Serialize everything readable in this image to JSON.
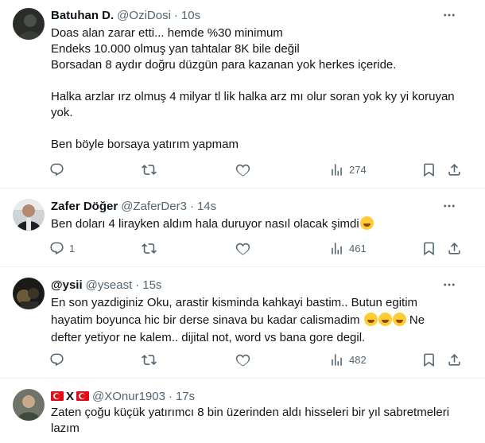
{
  "tweets": [
    {
      "name": "Batuhan D.",
      "handle": "@OziDosi",
      "time": "10s",
      "lines": [
        "Doas alan zarar etti... hemde %30 minimum",
        "Endeks 10.000 olmuş yan tahtalar 8K bile değil",
        "Borsadan 8 aydır doğru düzgün para kazanan yok herkes içeride.",
        "",
        "Halka arzlar ırz olmuş 4 milyar tl lik halka arz mı olur soran yok ky yi koruyan",
        "yok.",
        "",
        "Ben böyle borsaya yatırım yapmam"
      ],
      "views": "274"
    },
    {
      "name": "Zafer Döğer",
      "handle": "@ZaferDer3",
      "time": "14s",
      "text": "Ben doları 4 lirayken aldım hala duruyor nasıl olacak şimdi",
      "replies": "1",
      "views": "461"
    },
    {
      "name": "@ysii",
      "handle": "@yseast",
      "time": "15s",
      "line1": "En son yazdiginiz Oku, arastir kisminda kahkayi bastim.. Butun egitim",
      "line2": "hayatim boyunca hic bir derse sinava bu kadar calismadim",
      "line2_tail": "Ne",
      "line3": "defter yetiyor ne kalem.. dijital not, word vs bana gore degil.",
      "views": "482"
    },
    {
      "name": "X",
      "handle": "@XOnur1903",
      "time": "17s",
      "lines": [
        "Zaten çoğu küçük yatırımcı 8 bin üzerinden aldı hisseleri bir yıl sabretmeleri",
        "lazım"
      ]
    }
  ],
  "separator": "·",
  "icons": [
    "reply-icon",
    "retweet-icon",
    "like-icon",
    "views-icon",
    "bookmark-icon",
    "share-icon",
    "more-icon"
  ],
  "colors": {
    "text": "#0f1419",
    "secondary": "#536471",
    "border": "#eff3f4"
  }
}
